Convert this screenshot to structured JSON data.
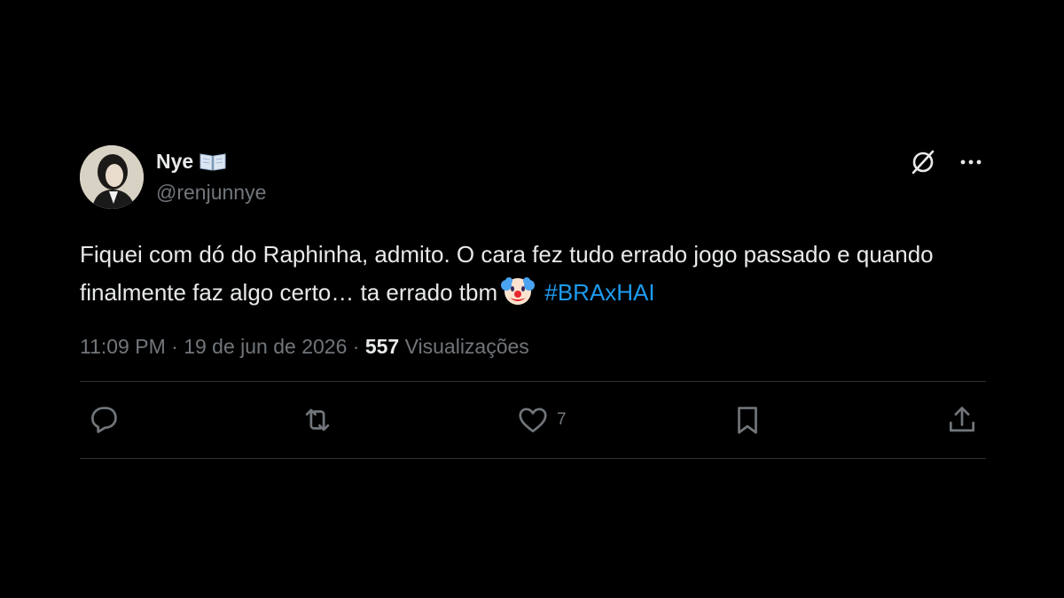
{
  "tweet": {
    "display_name": "Nye",
    "handle": "@renjunnye",
    "text_part1": "Fiquei com dó do Raphinha, admito. O cara fez tudo errado jogo passado e quando finalmente faz algo certo… ta errado tbm",
    "hashtag": "#BRAxHAI",
    "time": "11:09 PM",
    "date": "19 de jun de 2026",
    "views_count": "557",
    "views_label": "Visualizações",
    "separator": "·"
  },
  "actions": {
    "like_count": "7"
  },
  "icons": {
    "name_badge": "open-book-icon",
    "grok": "grok-icon",
    "more": "more-icon",
    "reply": "reply-icon",
    "retweet": "retweet-icon",
    "like": "heart-icon",
    "bookmark": "bookmark-icon",
    "share": "share-icon",
    "emoji": "clown-face-icon"
  },
  "colors": {
    "background": "#000000",
    "text": "#e7e9ea",
    "muted": "#71767b",
    "link": "#1d9bf0",
    "divider": "#2f3336"
  }
}
